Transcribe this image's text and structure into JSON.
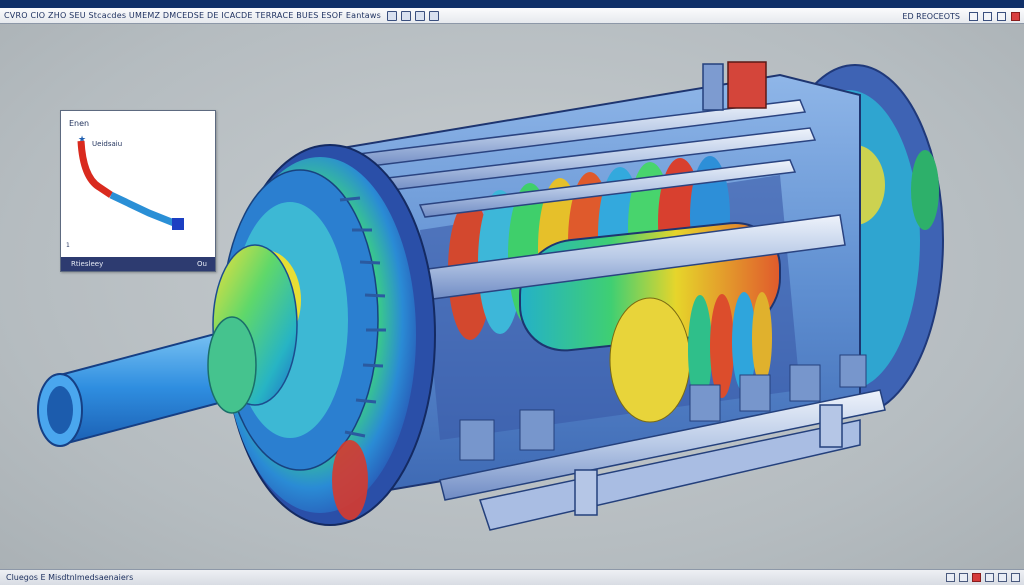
{
  "toolbar": {
    "text": "CVRO CIO ZHO SEU Stcacdes UMEMZ DMCEDSE DE ICACDE TERRACE BUES ESOF Eantaws",
    "right_label": "ED REOCEOTS"
  },
  "graph": {
    "title": "Enen",
    "legend": "Ueidsaiu",
    "marker": "★",
    "axis_label": "1",
    "footer_left": "Rtiesleey",
    "footer_right": "Ou",
    "colors": [
      "#d92a1e",
      "#e0562a",
      "#2a8fd6",
      "#2a66d9",
      "#1c3fc2"
    ]
  },
  "status": {
    "text": "Cluegos  E Misdtnlmedsaenaiers"
  }
}
